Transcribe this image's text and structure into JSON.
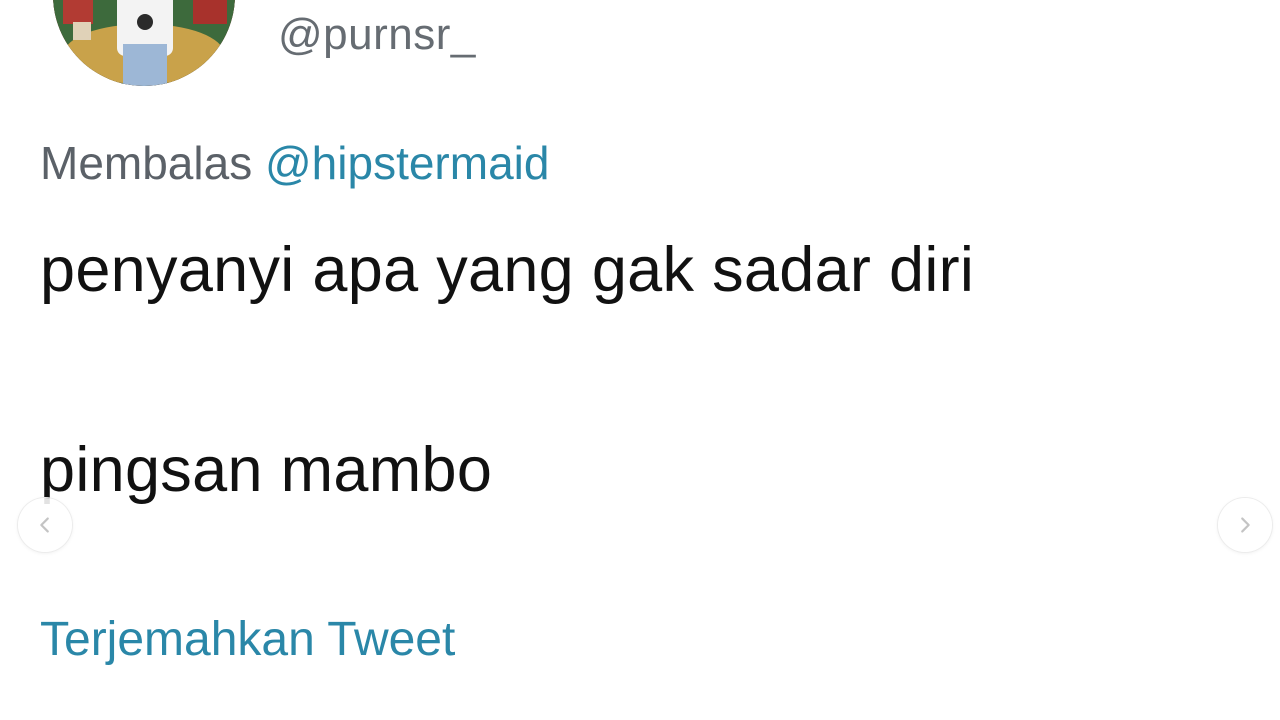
{
  "tweet": {
    "handle": "@purnsr_",
    "reply_prefix": "Membalas",
    "reply_mention": "@hipstermaid",
    "text_line_1": "penyanyi apa yang gak sadar diri",
    "text_line_2": "pingsan mambo",
    "translate_label": "Terjemahkan Tweet"
  },
  "carousel": {
    "prev_icon": "chevron-left-icon",
    "next_icon": "chevron-right-icon"
  },
  "colors": {
    "link": "#2a87a8",
    "muted": "#5b6168",
    "text": "#111111"
  }
}
